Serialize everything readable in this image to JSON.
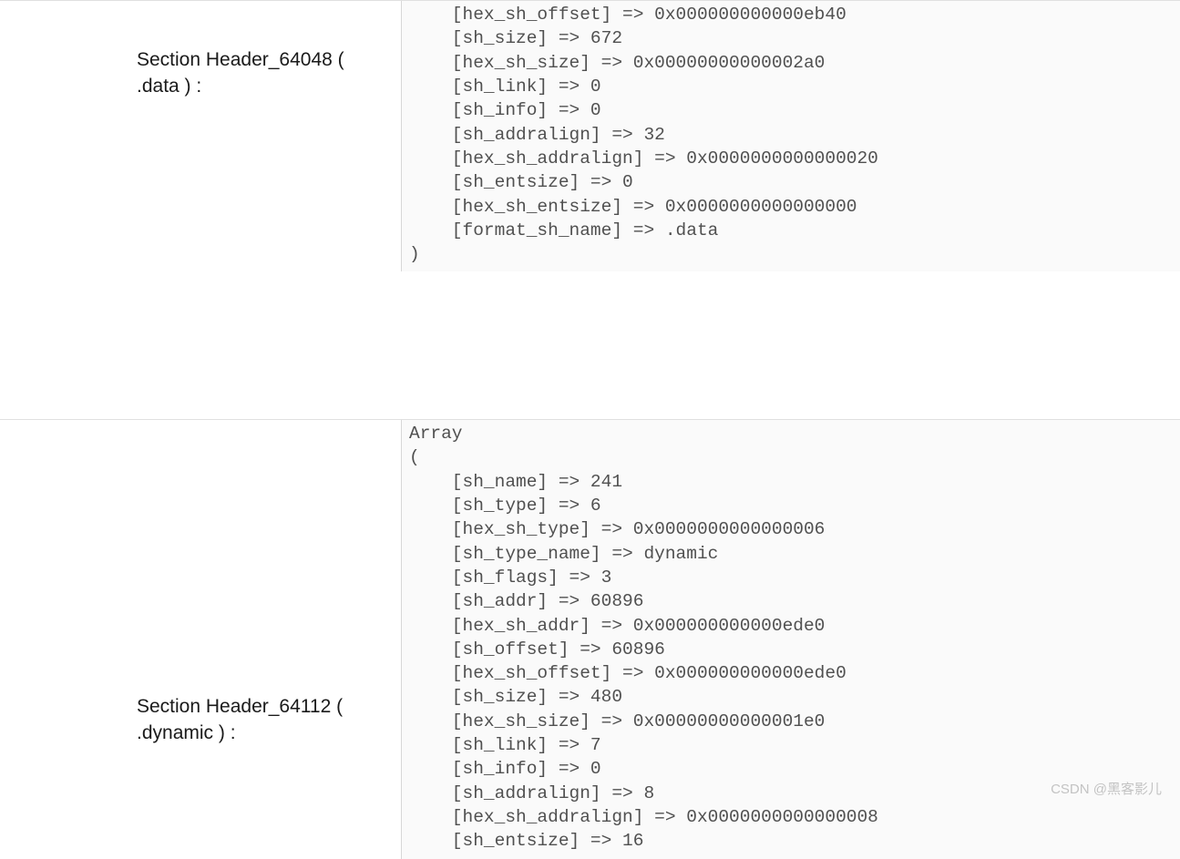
{
  "sections": [
    {
      "label": "Section Header_64048 ( .data ) :",
      "code": "    [hex_sh_offset] => 0x000000000000eb40\n    [sh_size] => 672\n    [hex_sh_size] => 0x00000000000002a0\n    [sh_link] => 0\n    [sh_info] => 0\n    [sh_addralign] => 32\n    [hex_sh_addralign] => 0x0000000000000020\n    [sh_entsize] => 0\n    [hex_sh_entsize] => 0x0000000000000000\n    [format_sh_name] => .data\n)"
    },
    {
      "label": "Section Header_64112 ( .dynamic ) :",
      "code": "Array\n(\n    [sh_name] => 241\n    [sh_type] => 6\n    [hex_sh_type] => 0x0000000000000006\n    [sh_type_name] => dynamic\n    [sh_flags] => 3\n    [sh_addr] => 60896\n    [hex_sh_addr] => 0x000000000000ede0\n    [sh_offset] => 60896\n    [hex_sh_offset] => 0x000000000000ede0\n    [sh_size] => 480\n    [hex_sh_size] => 0x00000000000001e0\n    [sh_link] => 7\n    [sh_info] => 0\n    [sh_addralign] => 8\n    [hex_sh_addralign] => 0x0000000000000008\n    [sh_entsize] => 16"
    }
  ],
  "watermark": "CSDN @黑客影儿"
}
